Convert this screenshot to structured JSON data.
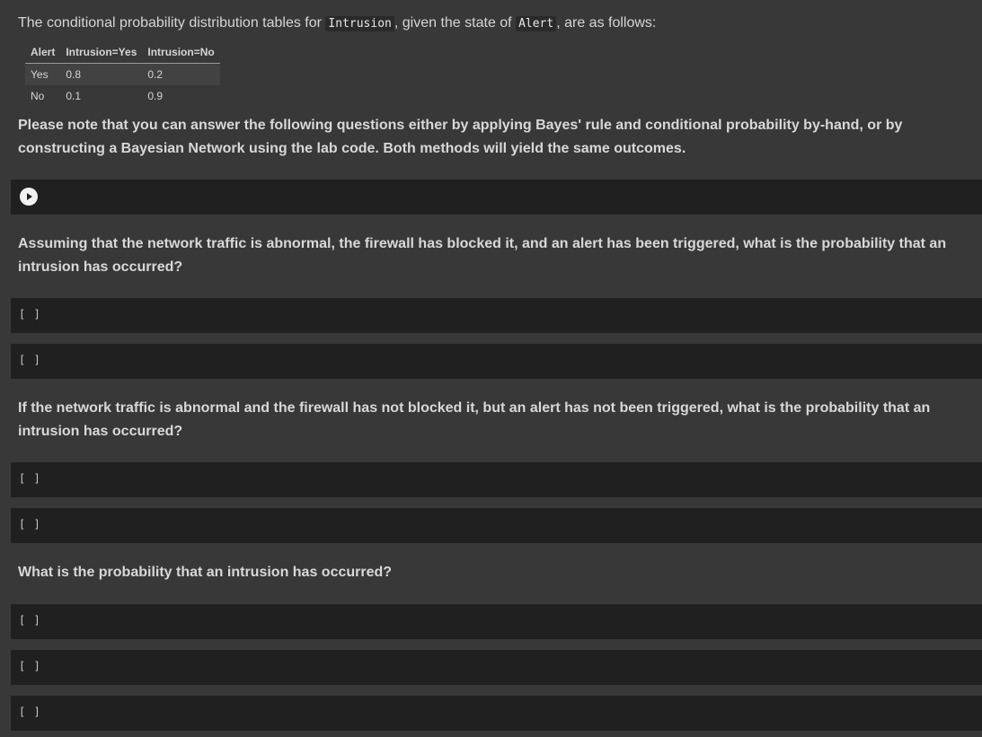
{
  "intro": {
    "before": "The conditional probability distribution tables for ",
    "code1": "Intrusion",
    "middle": ", given the state of ",
    "code2": "Alert",
    "after": ", are as follows:"
  },
  "cpt_table": {
    "headers": [
      "Alert",
      "Intrusion=Yes",
      "Intrusion=No"
    ],
    "rows": [
      [
        "Yes",
        "0.8",
        "0.2"
      ],
      [
        "No",
        "0.1",
        "0.9"
      ]
    ]
  },
  "note": "Please note that you can answer the following questions either by applying Bayes' rule and conditional probability by-hand, or by constructing a Bayesian Network using the lab code. Both methods will yield the same outcomes.",
  "run_cell": {
    "icon": "play-icon"
  },
  "questions": [
    "Assuming that the network traffic is abnormal, the firewall has blocked it, and an alert has been triggered, what is the probability that an intrusion has occurred?",
    "If the network traffic is abnormal and the firewall has not blocked it, but an alert has not been triggered, what is the probability that an intrusion has occurred?",
    "What is the probability that an intrusion has occurred?"
  ],
  "cell_prompt": "[ ]",
  "colors": {
    "background": "#383838",
    "cell_background": "#202020",
    "text": "#d5d5d5"
  }
}
